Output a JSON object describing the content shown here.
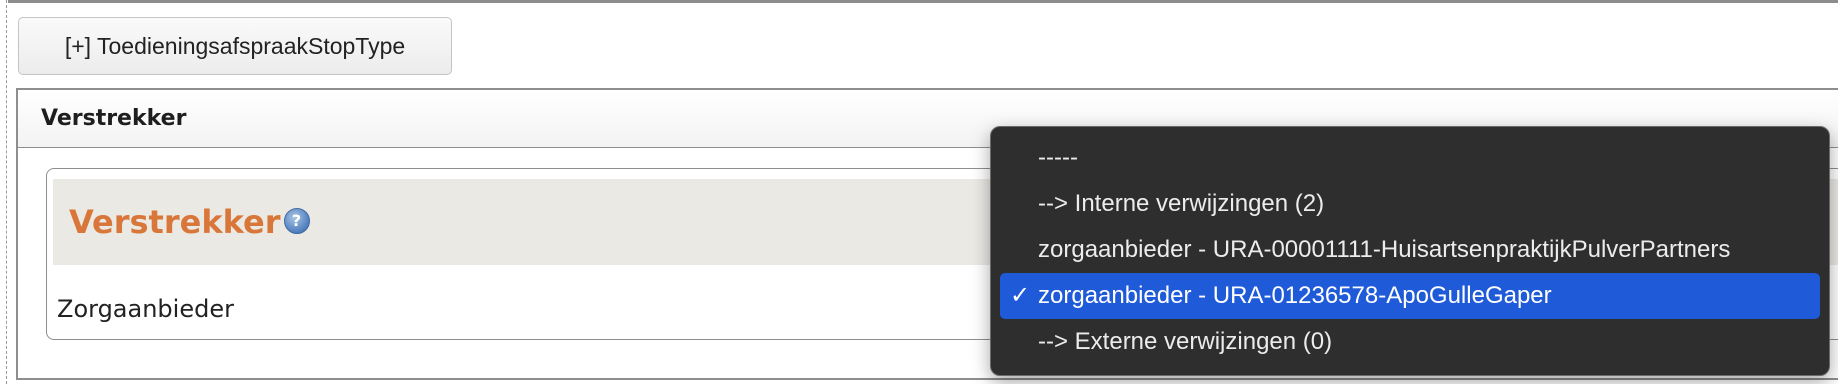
{
  "toolbar": {
    "toggle_label": "[+] ToedieningsafspraakStopType"
  },
  "section": {
    "header_title": "Verstrekker",
    "inner_title": "Verstrekker",
    "help_glyph": "?",
    "field_label": "Zorgaanbieder"
  },
  "dropdown": {
    "selected_index": 3,
    "check_glyph": "✓",
    "options": [
      {
        "label": "-----"
      },
      {
        "label": "--> Interne verwijzingen (2)"
      },
      {
        "label": "zorgaanbieder - URA-00001111-HuisartsenpraktijkPulverPartners"
      },
      {
        "label": "zorgaanbieder - URA-01236578-ApoGulleGaper"
      },
      {
        "label": "--> Externe verwijzingen (0)"
      }
    ]
  },
  "colors": {
    "accent_title": "#d9773a",
    "menu_background": "#2e2e2e",
    "menu_selected": "#1f5ad8"
  },
  "icons": {
    "help": "help-icon",
    "check": "check-icon"
  }
}
